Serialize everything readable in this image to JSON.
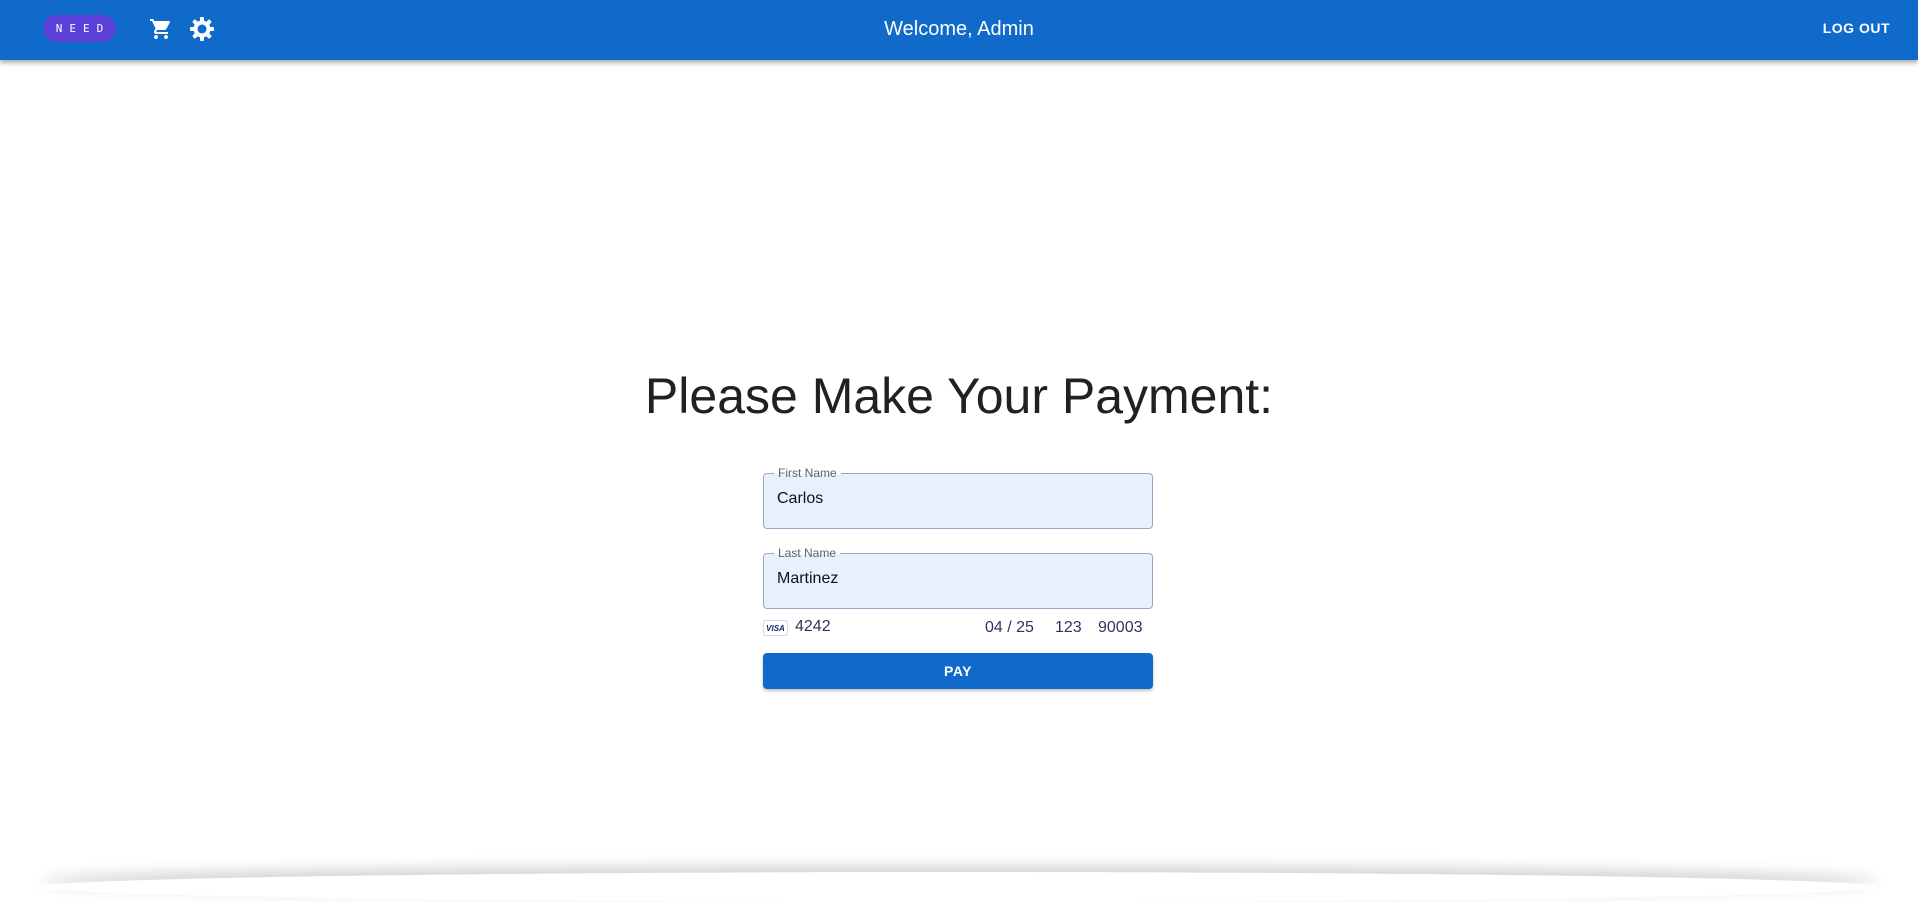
{
  "app_bar": {
    "logo_text": "NEED",
    "title": "Welcome, Admin",
    "logout_label": "LOG OUT",
    "cart_icon": "shopping-cart-icon",
    "settings_icon": "gear-icon",
    "color": "#0f6ac9"
  },
  "main": {
    "title": "Please Make Your Payment:",
    "first_name": {
      "label": "First Name",
      "value": "Carlos"
    },
    "last_name": {
      "label": "Last Name",
      "value": "Martinez"
    },
    "card": {
      "brand": "VISA",
      "brand_icon": "visa-icon",
      "number": "4242",
      "expiry": "04 / 25",
      "cvc": "123",
      "zip": "90003"
    },
    "pay_label": "PAY"
  }
}
